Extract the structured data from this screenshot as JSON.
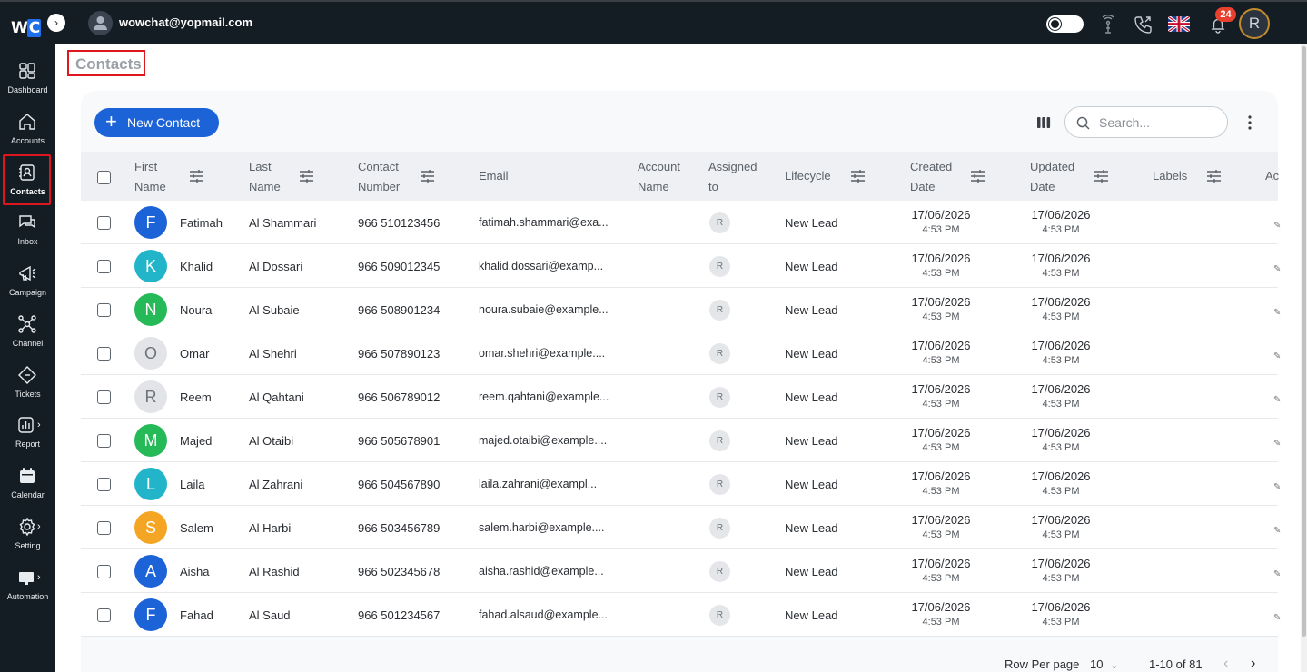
{
  "app": {
    "logo": {
      "w": "W",
      "c": "C"
    },
    "user_email": "wowchat@yopmail.com",
    "notification_count": "24",
    "profile_initial": "R",
    "accent_color": "#1d63d8",
    "highlight_color": "#e0161f"
  },
  "sidebar": {
    "items": [
      {
        "label": "Dashboard",
        "icon": "dashboard-icon"
      },
      {
        "label": "Accounts",
        "icon": "home-icon"
      },
      {
        "label": "Contacts",
        "icon": "contacts-icon",
        "active": true
      },
      {
        "label": "Inbox",
        "icon": "chat-icon"
      },
      {
        "label": "Campaign",
        "icon": "megaphone-icon"
      },
      {
        "label": "Channel",
        "icon": "network-icon"
      },
      {
        "label": "Tickets",
        "icon": "ticket-icon"
      },
      {
        "label": "Report",
        "icon": "chart-icon"
      },
      {
        "label": "Calendar",
        "icon": "calendar-icon"
      },
      {
        "label": "Setting",
        "icon": "gear-icon"
      },
      {
        "label": "Automation",
        "icon": "automation-icon"
      }
    ]
  },
  "page": {
    "title": "Contacts",
    "new_contact_label": "New Contact",
    "search_placeholder": "Search..."
  },
  "table": {
    "headers": {
      "first_name": [
        "First",
        "Name"
      ],
      "last_name": [
        "Last",
        "Name"
      ],
      "contact_number": [
        "Contact",
        "Number"
      ],
      "email": "Email",
      "account_name": [
        "Account",
        "Name"
      ],
      "assigned_to": [
        "Assigned",
        "to"
      ],
      "lifecycle": "Lifecycle",
      "created_date": [
        "Created",
        "Date"
      ],
      "updated_date": [
        "Updated",
        "Date"
      ],
      "labels": "Labels",
      "next_col": "Ac"
    },
    "rows": [
      {
        "initial": "F",
        "color": "#1d63d8",
        "first": "Fatimah",
        "last": "Al Shammari",
        "phone": "966 510123456",
        "email": "fatimah.shammari@exa...",
        "assigned": "R",
        "lifecycle": "New Lead",
        "created_date": "17/06/2026",
        "created_time": "4:53 PM",
        "updated_date": "17/06/2026",
        "updated_time": "4:53 PM"
      },
      {
        "initial": "K",
        "color": "#22b5c9",
        "first": "Khalid",
        "last": "Al Dossari",
        "phone": "966 509012345",
        "email": "khalid.dossari@examp...",
        "assigned": "R",
        "lifecycle": "New Lead",
        "created_date": "17/06/2026",
        "created_time": "4:53 PM",
        "updated_date": "17/06/2026",
        "updated_time": "4:53 PM"
      },
      {
        "initial": "N",
        "color": "#26b957",
        "first": "Noura",
        "last": "Al Subaie",
        "phone": "966 508901234",
        "email": "noura.subaie@example...",
        "assigned": "R",
        "lifecycle": "New Lead",
        "created_date": "17/06/2026",
        "created_time": "4:53 PM",
        "updated_date": "17/06/2026",
        "updated_time": "4:53 PM"
      },
      {
        "initial": "O",
        "color": "#e2e4e7",
        "first": "Omar",
        "last": "Al Shehri",
        "phone": "966 507890123",
        "email": "omar.shehri@example....",
        "assigned": "R",
        "lifecycle": "New Lead",
        "created_date": "17/06/2026",
        "created_time": "4:53 PM",
        "updated_date": "17/06/2026",
        "updated_time": "4:53 PM"
      },
      {
        "initial": "R",
        "color": "#e2e4e7",
        "first": "Reem",
        "last": "Al Qahtani",
        "phone": "966 506789012",
        "email": "reem.qahtani@example...",
        "assigned": "R",
        "lifecycle": "New Lead",
        "created_date": "17/06/2026",
        "created_time": "4:53 PM",
        "updated_date": "17/06/2026",
        "updated_time": "4:53 PM"
      },
      {
        "initial": "M",
        "color": "#26b957",
        "first": "Majed",
        "last": "Al Otaibi",
        "phone": "966 505678901",
        "email": "majed.otaibi@example....",
        "assigned": "R",
        "lifecycle": "New Lead",
        "created_date": "17/06/2026",
        "created_time": "4:53 PM",
        "updated_date": "17/06/2026",
        "updated_time": "4:53 PM"
      },
      {
        "initial": "L",
        "color": "#22b5c9",
        "first": "Laila",
        "last": "Al Zahrani",
        "phone": "966 504567890",
        "email": "laila.zahrani@exampl...",
        "assigned": "R",
        "lifecycle": "New Lead",
        "created_date": "17/06/2026",
        "created_time": "4:53 PM",
        "updated_date": "17/06/2026",
        "updated_time": "4:53 PM"
      },
      {
        "initial": "S",
        "color": "#f4a524",
        "first": "Salem",
        "last": "Al Harbi",
        "phone": "966 503456789",
        "email": "salem.harbi@example....",
        "assigned": "R",
        "lifecycle": "New Lead",
        "created_date": "17/06/2026",
        "created_time": "4:53 PM",
        "updated_date": "17/06/2026",
        "updated_time": "4:53 PM"
      },
      {
        "initial": "A",
        "color": "#1d63d8",
        "first": "Aisha",
        "last": "Al Rashid",
        "phone": "966 502345678",
        "email": "aisha.rashid@example...",
        "assigned": "R",
        "lifecycle": "New Lead",
        "created_date": "17/06/2026",
        "created_time": "4:53 PM",
        "updated_date": "17/06/2026",
        "updated_time": "4:53 PM"
      },
      {
        "initial": "F",
        "color": "#1d63d8",
        "first": "Fahad",
        "last": "Al Saud",
        "phone": "966 501234567",
        "email": "fahad.alsaud@example...",
        "assigned": "R",
        "lifecycle": "New Lead",
        "created_date": "17/06/2026",
        "created_time": "4:53 PM",
        "updated_date": "17/06/2026",
        "updated_time": "4:53 PM"
      }
    ]
  },
  "pagination": {
    "rows_per_page_label": "Row Per page",
    "rows_per_page_value": "10",
    "range": "1-10 of 81"
  }
}
